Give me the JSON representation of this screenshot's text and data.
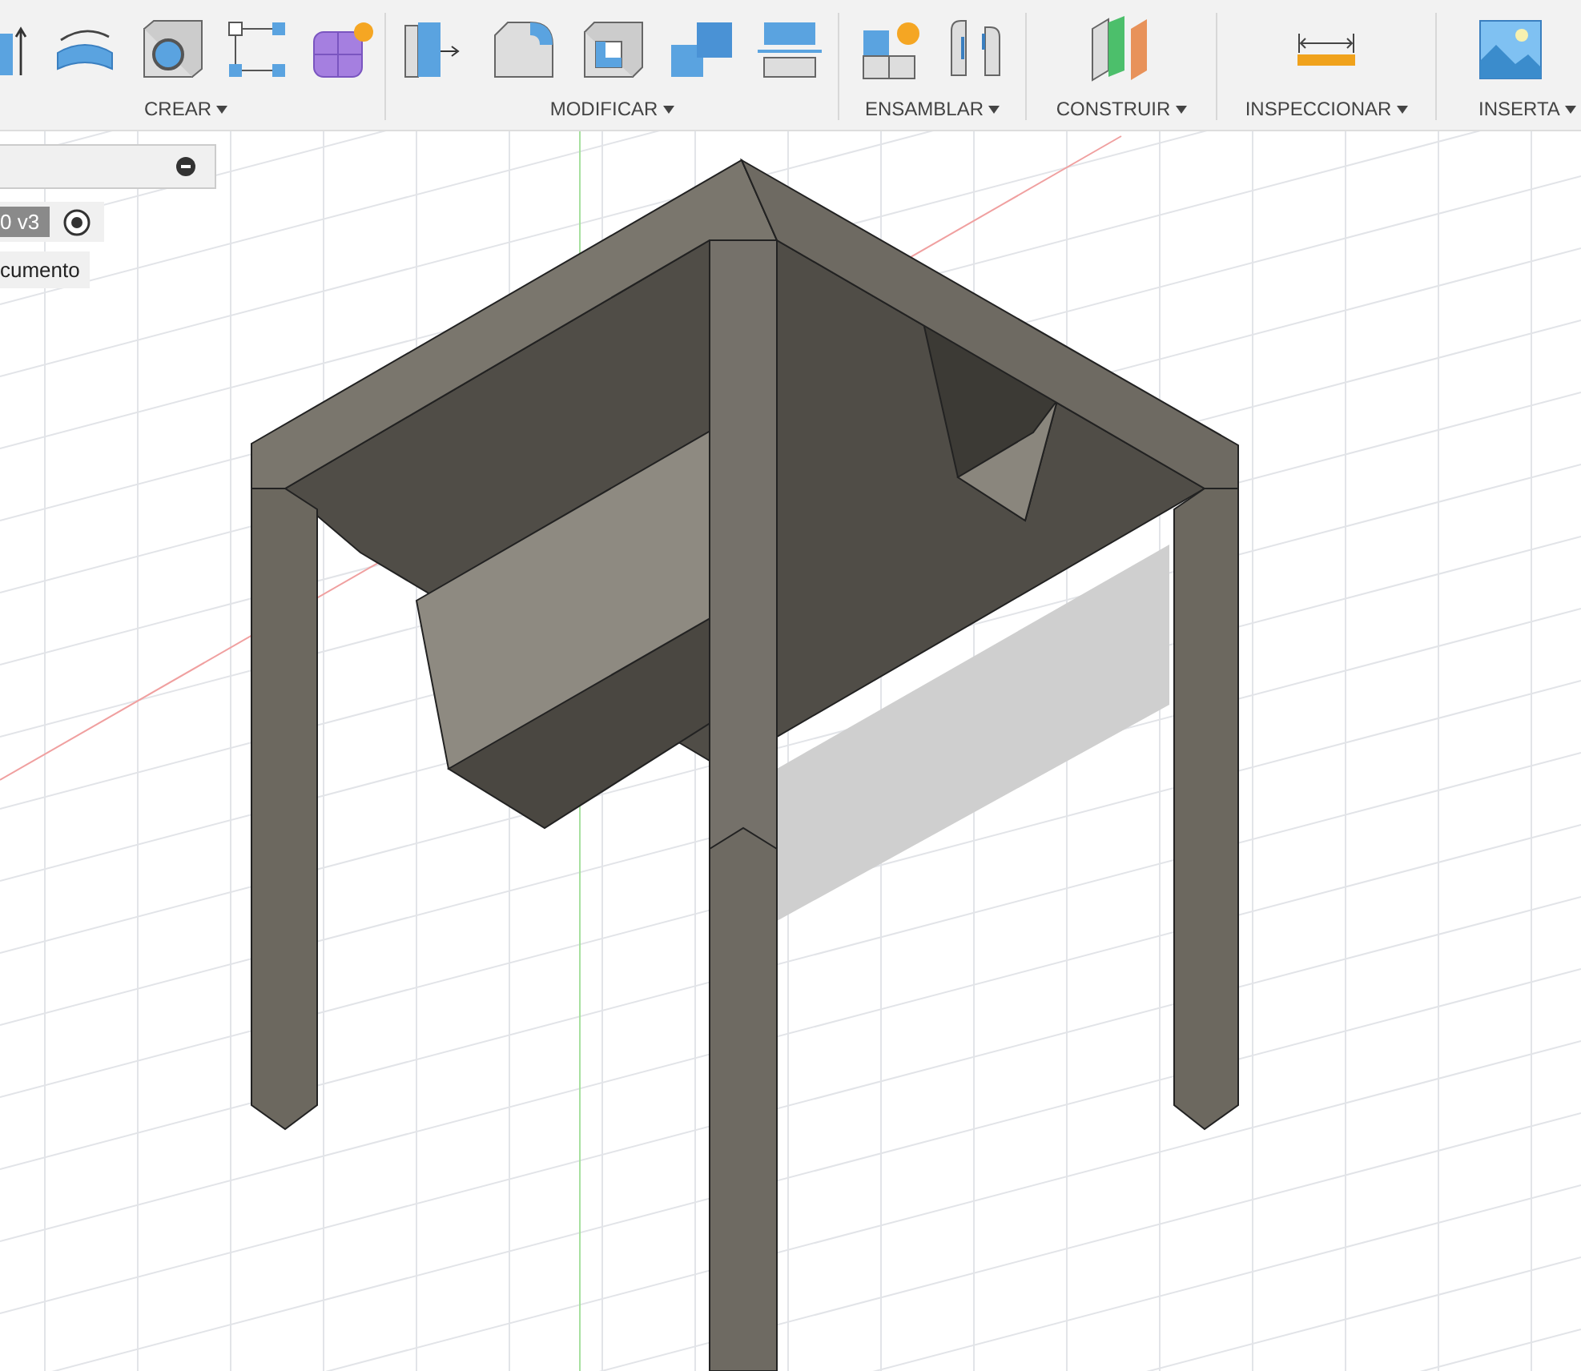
{
  "toolbar": {
    "groups": [
      {
        "label": "CREAR",
        "kind": "crear"
      },
      {
        "label": "MODIFICAR",
        "kind": "modificar"
      },
      {
        "label": "ENSAMBLAR",
        "kind": "ensamblar"
      },
      {
        "label": "CONSTRUIR",
        "kind": "construir"
      },
      {
        "label": "INSPECCIONAR",
        "kind": "inspeccionar"
      },
      {
        "label": "INSERTA",
        "kind": "insertar"
      }
    ]
  },
  "browser": {
    "version_label": "0 v3",
    "item_label": "cumento"
  }
}
